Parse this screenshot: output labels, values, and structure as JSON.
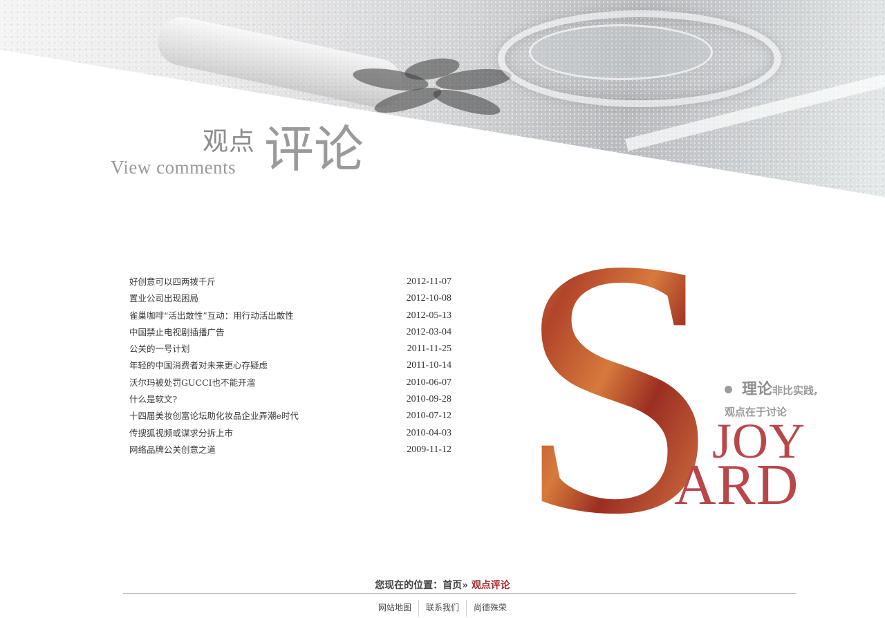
{
  "header": {
    "title_cn_small": "观点",
    "title_cn_big": "评论",
    "title_en": "View comments"
  },
  "articles": [
    {
      "title": "好创意可以四两拨千斤",
      "date": "2012-11-07"
    },
    {
      "title": "置业公司出现困局",
      "date": "2012-10-08"
    },
    {
      "title": "雀巢咖啡“活出敢性”互动：用行动活出敢性",
      "date": "2012-05-13"
    },
    {
      "title": "中国禁止电视剧插播广告",
      "date": "2012-03-04"
    },
    {
      "title": "公关的一号计划",
      "date": "2011-11-25"
    },
    {
      "title": "年轻的中国消费者对未来更心存疑虑",
      "date": "2011-10-14"
    },
    {
      "title": "沃尔玛被处罚GUCCI也不能开溜",
      "date": "2010-06-07"
    },
    {
      "title": "什么是软文?",
      "date": "2010-09-28"
    },
    {
      "title": "十四届美妆创富论坛助化妆品企业弄潮e时代",
      "date": "2010-07-12"
    },
    {
      "title": "传搜狐视频或谋求分拆上市",
      "date": "2010-04-03"
    },
    {
      "title": "网络品牌公关创意之道",
      "date": "2009-11-12"
    }
  ],
  "brand": {
    "slogan_big": "理论",
    "slogan_rest": "非比实践,",
    "slogan_line2": "观点在于讨论",
    "joy": "JOY",
    "ard": "ARD",
    "accent_color": "#b9474a"
  },
  "breadcrumb": {
    "prefix": "您现在的位置：",
    "home": "首页",
    "separator": "»",
    "current": "观点评论"
  },
  "footer": {
    "links": [
      "网站地图",
      "联系我们",
      "尚德殊荣"
    ]
  }
}
